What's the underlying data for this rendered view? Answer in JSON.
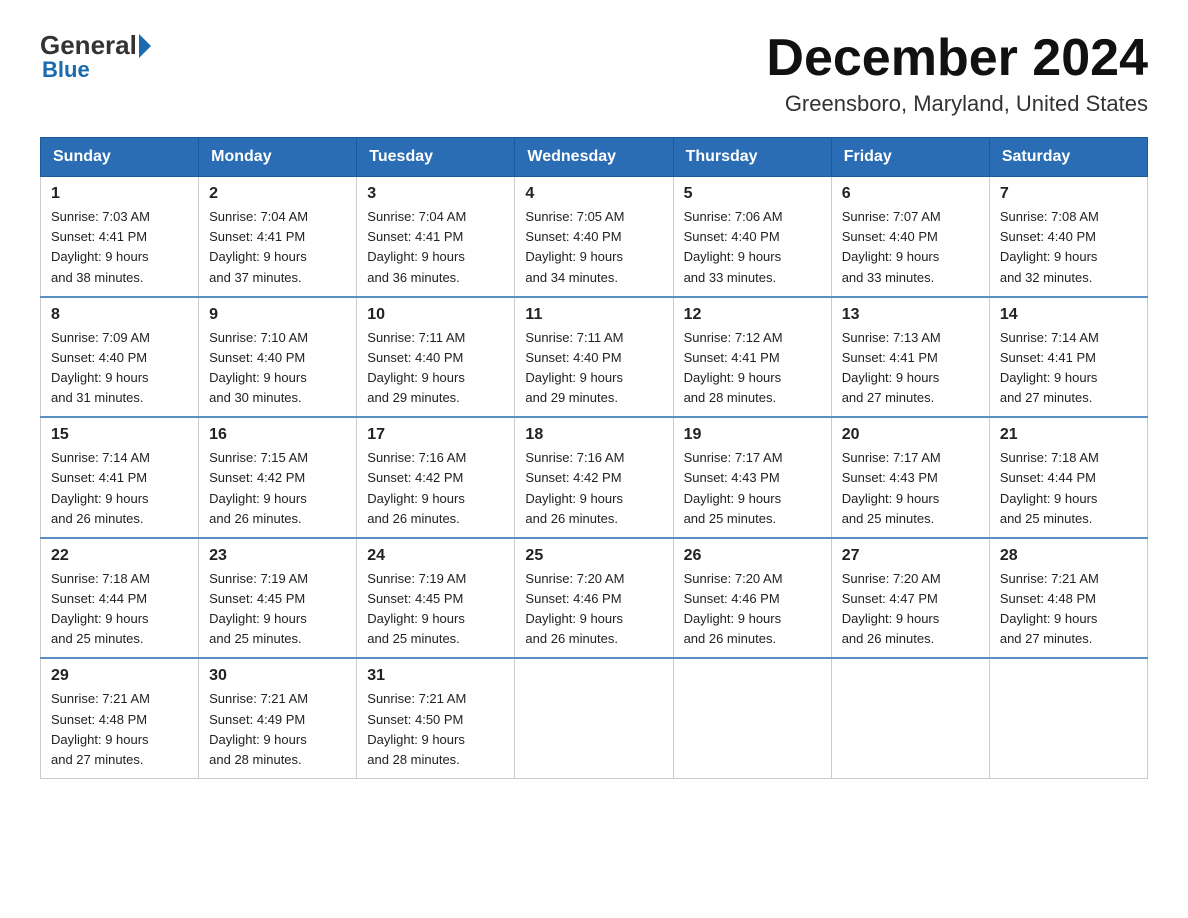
{
  "logo": {
    "general": "General",
    "blue": "Blue"
  },
  "header": {
    "title": "December 2024",
    "subtitle": "Greensboro, Maryland, United States"
  },
  "weekdays": [
    "Sunday",
    "Monday",
    "Tuesday",
    "Wednesday",
    "Thursday",
    "Friday",
    "Saturday"
  ],
  "weeks": [
    [
      {
        "day": "1",
        "sunrise": "7:03 AM",
        "sunset": "4:41 PM",
        "daylight": "9 hours and 38 minutes."
      },
      {
        "day": "2",
        "sunrise": "7:04 AM",
        "sunset": "4:41 PM",
        "daylight": "9 hours and 37 minutes."
      },
      {
        "day": "3",
        "sunrise": "7:04 AM",
        "sunset": "4:41 PM",
        "daylight": "9 hours and 36 minutes."
      },
      {
        "day": "4",
        "sunrise": "7:05 AM",
        "sunset": "4:40 PM",
        "daylight": "9 hours and 34 minutes."
      },
      {
        "day": "5",
        "sunrise": "7:06 AM",
        "sunset": "4:40 PM",
        "daylight": "9 hours and 33 minutes."
      },
      {
        "day": "6",
        "sunrise": "7:07 AM",
        "sunset": "4:40 PM",
        "daylight": "9 hours and 33 minutes."
      },
      {
        "day": "7",
        "sunrise": "7:08 AM",
        "sunset": "4:40 PM",
        "daylight": "9 hours and 32 minutes."
      }
    ],
    [
      {
        "day": "8",
        "sunrise": "7:09 AM",
        "sunset": "4:40 PM",
        "daylight": "9 hours and 31 minutes."
      },
      {
        "day": "9",
        "sunrise": "7:10 AM",
        "sunset": "4:40 PM",
        "daylight": "9 hours and 30 minutes."
      },
      {
        "day": "10",
        "sunrise": "7:11 AM",
        "sunset": "4:40 PM",
        "daylight": "9 hours and 29 minutes."
      },
      {
        "day": "11",
        "sunrise": "7:11 AM",
        "sunset": "4:40 PM",
        "daylight": "9 hours and 29 minutes."
      },
      {
        "day": "12",
        "sunrise": "7:12 AM",
        "sunset": "4:41 PM",
        "daylight": "9 hours and 28 minutes."
      },
      {
        "day": "13",
        "sunrise": "7:13 AM",
        "sunset": "4:41 PM",
        "daylight": "9 hours and 27 minutes."
      },
      {
        "day": "14",
        "sunrise": "7:14 AM",
        "sunset": "4:41 PM",
        "daylight": "9 hours and 27 minutes."
      }
    ],
    [
      {
        "day": "15",
        "sunrise": "7:14 AM",
        "sunset": "4:41 PM",
        "daylight": "9 hours and 26 minutes."
      },
      {
        "day": "16",
        "sunrise": "7:15 AM",
        "sunset": "4:42 PM",
        "daylight": "9 hours and 26 minutes."
      },
      {
        "day": "17",
        "sunrise": "7:16 AM",
        "sunset": "4:42 PM",
        "daylight": "9 hours and 26 minutes."
      },
      {
        "day": "18",
        "sunrise": "7:16 AM",
        "sunset": "4:42 PM",
        "daylight": "9 hours and 26 minutes."
      },
      {
        "day": "19",
        "sunrise": "7:17 AM",
        "sunset": "4:43 PM",
        "daylight": "9 hours and 25 minutes."
      },
      {
        "day": "20",
        "sunrise": "7:17 AM",
        "sunset": "4:43 PM",
        "daylight": "9 hours and 25 minutes."
      },
      {
        "day": "21",
        "sunrise": "7:18 AM",
        "sunset": "4:44 PM",
        "daylight": "9 hours and 25 minutes."
      }
    ],
    [
      {
        "day": "22",
        "sunrise": "7:18 AM",
        "sunset": "4:44 PM",
        "daylight": "9 hours and 25 minutes."
      },
      {
        "day": "23",
        "sunrise": "7:19 AM",
        "sunset": "4:45 PM",
        "daylight": "9 hours and 25 minutes."
      },
      {
        "day": "24",
        "sunrise": "7:19 AM",
        "sunset": "4:45 PM",
        "daylight": "9 hours and 25 minutes."
      },
      {
        "day": "25",
        "sunrise": "7:20 AM",
        "sunset": "4:46 PM",
        "daylight": "9 hours and 26 minutes."
      },
      {
        "day": "26",
        "sunrise": "7:20 AM",
        "sunset": "4:46 PM",
        "daylight": "9 hours and 26 minutes."
      },
      {
        "day": "27",
        "sunrise": "7:20 AM",
        "sunset": "4:47 PM",
        "daylight": "9 hours and 26 minutes."
      },
      {
        "day": "28",
        "sunrise": "7:21 AM",
        "sunset": "4:48 PM",
        "daylight": "9 hours and 27 minutes."
      }
    ],
    [
      {
        "day": "29",
        "sunrise": "7:21 AM",
        "sunset": "4:48 PM",
        "daylight": "9 hours and 27 minutes."
      },
      {
        "day": "30",
        "sunrise": "7:21 AM",
        "sunset": "4:49 PM",
        "daylight": "9 hours and 28 minutes."
      },
      {
        "day": "31",
        "sunrise": "7:21 AM",
        "sunset": "4:50 PM",
        "daylight": "9 hours and 28 minutes."
      },
      null,
      null,
      null,
      null
    ]
  ]
}
